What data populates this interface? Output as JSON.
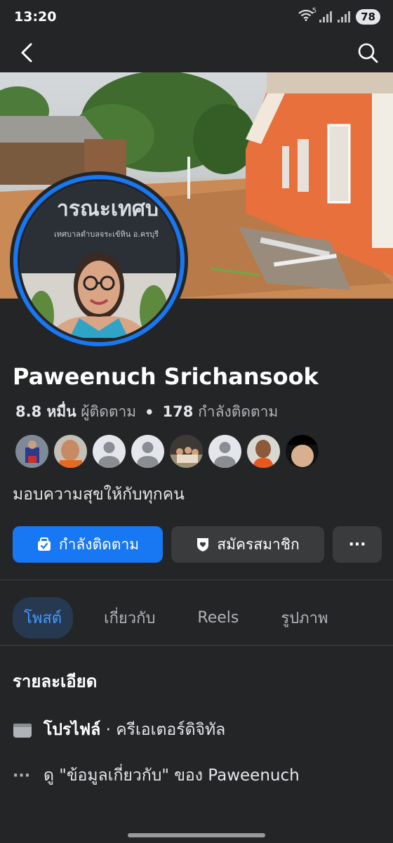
{
  "status": {
    "time": "13:20",
    "battery": "78",
    "wifi_badge": "5"
  },
  "profile": {
    "name": "Paweenuch Srichansook",
    "followers_count": "8.8 หมื่น",
    "followers_label": "ผู้ติดตาม",
    "following_count": "178",
    "following_label": "กำลังติดตาม",
    "bio": "มอบความสุขให้กับทุกคน",
    "cover_sign_text": "ารณะเทศบ",
    "cover_sign_subtext": "เทศบาลตำบลจระเข้หิน อ.ครบุรี"
  },
  "actions": {
    "following_label": "กำลังติดตาม",
    "subscribe_label": "สมัครสมาชิก",
    "more_label": "···"
  },
  "tabs": [
    {
      "label": "โพสต์",
      "active": true
    },
    {
      "label": "เกี่ยวกับ",
      "active": false
    },
    {
      "label": "Reels",
      "active": false
    },
    {
      "label": "รูปภาพ",
      "active": false
    }
  ],
  "details": {
    "title": "รายละเอียด",
    "profile_type_bold": "โปรไฟล์",
    "profile_type_rest": " · ครีเอเตอร์ดิจิทัล",
    "about_link": "ดู \"ข้อมูลเกี่ยวกับ\" ของ Paweenuch"
  },
  "colors": {
    "accent": "#1877f2",
    "background": "#242526",
    "button_gray": "#3a3b3c",
    "tab_active_bg": "#263951"
  }
}
